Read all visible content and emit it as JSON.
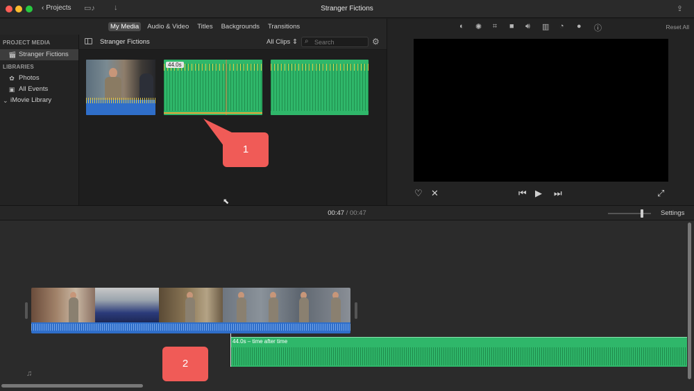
{
  "window": {
    "title": "Stranger Fictions",
    "projects_label": "Projects"
  },
  "browser_tabs": [
    "My Media",
    "Audio & Video",
    "Titles",
    "Backgrounds",
    "Transitions"
  ],
  "sidebar": {
    "project_media_heading": "PROJECT MEDIA",
    "project_item": "Stranger Fictions",
    "libraries_heading": "LIBRARIES",
    "library_items": [
      "Photos",
      "All Events",
      "iMovie Library"
    ]
  },
  "media_header": {
    "title": "Stranger Fictions",
    "filter": "All Clips",
    "search_placeholder": "Search"
  },
  "media_clips": [
    {
      "kind": "video"
    },
    {
      "kind": "audio",
      "duration": "44.0s"
    },
    {
      "kind": "audio"
    }
  ],
  "viewer": {
    "reset_label": "Reset All"
  },
  "timeline": {
    "current_time": "00:47",
    "separator": "/",
    "total_time": "00:47",
    "settings_label": "Settings",
    "music_clip_label": "44.0s – time after time"
  },
  "callouts": {
    "one": "1",
    "two": "2"
  },
  "colors": {
    "audio_green": "#2fb76a",
    "video_audio_blue": "#2f6ec9",
    "callout_red": "#f05b57",
    "close": "#fe5f57",
    "minimize": "#febc2e",
    "zoom": "#28c840"
  },
  "icons": {
    "back": "chevron-left-icon",
    "media_import": "film-icon",
    "download": "arrow-down-icon",
    "share": "share-icon",
    "magic_wand": "magic-wand-icon",
    "favorite": "heart-icon",
    "reject": "reject-icon",
    "previous": "skip-back-icon",
    "play": "play-icon",
    "next": "skip-forward-icon",
    "fullscreen": "fullscreen-icon"
  }
}
